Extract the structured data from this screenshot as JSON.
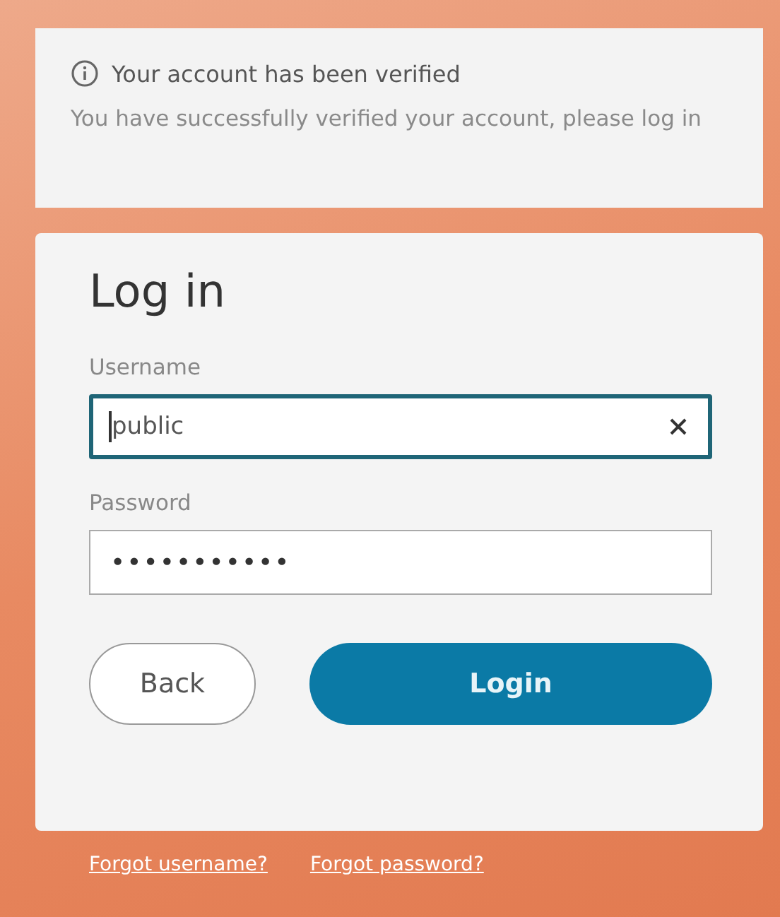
{
  "notice": {
    "title": "Your account has been verified",
    "message": "You have successfully verified your account, please log in"
  },
  "login": {
    "title": "Log in",
    "fields": [
      {
        "label": "Username",
        "value": "public",
        "kind": "text",
        "focused": true
      },
      {
        "label": "Password",
        "value": "•••••••••••",
        "kind": "password",
        "focused": false
      }
    ],
    "buttons": [
      {
        "label": "Back",
        "kind": "secondary"
      },
      {
        "label": "Login",
        "kind": "primary"
      }
    ]
  },
  "links": [
    "Forgot username?",
    "Forgot password?"
  ]
}
